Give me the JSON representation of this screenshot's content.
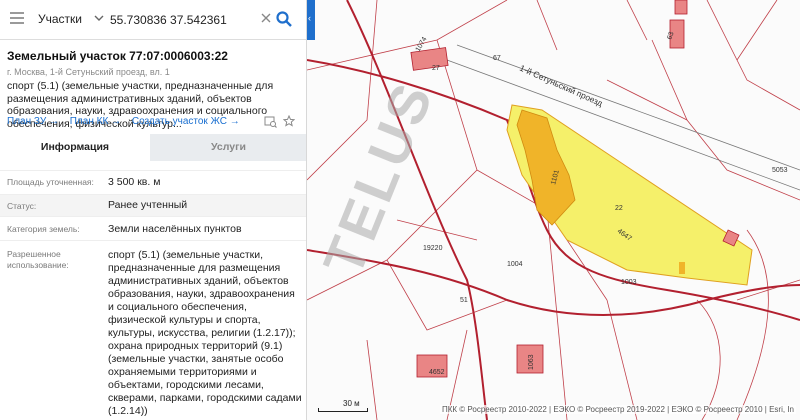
{
  "search": {
    "layer": "Участки",
    "value": "55.730836 37.542361"
  },
  "parcel": {
    "title": "Земельный участок 77:07:0006003:22",
    "address": "г. Москва, 1-й Сетуньский проезд, вл. 1",
    "description": "спорт (5.1) (земельные участки, предназначенные для размещения административных зданий, объектов образования, науки, здравоохранения и социального обеспечения, физической культур...",
    "links": {
      "plan_zu": "План ЗУ →",
      "plan_kk": "План КК →",
      "create_zs": "Создать участок ЖС →"
    }
  },
  "tabs": {
    "info": "Информация",
    "services": "Услуги"
  },
  "attributes": {
    "area_label": "Площадь уточненная:",
    "area_value": "3 500 кв. м",
    "status_label": "Статус:",
    "status_value": "Ранее учтенный",
    "category_label": "Категория земель:",
    "category_value": "Земли населённых пунктов",
    "use_label_1": "Разрешенное",
    "use_label_2": "использование:",
    "use_value": "спорт (5.1) (земельные участки, предназначенные для размещения административных зданий, объектов образования, науки, здравоохранения и социального обеспечения, физической культуры и спорта, культуры, искусства, религии (1.2.17)); охрана природных территорий (9.1) (земельные участки, занятые особо охраняемыми территориями и объектами, городскими лесами, скверами, парками, городскими садами (1.2.14))"
  },
  "map": {
    "street": "1-й Сетуньский проезд",
    "labels": {
      "l1074": "1074",
      "l27": "27",
      "l67": "67",
      "l63": "63",
      "l22": "22",
      "l4647": "4647",
      "l19220": "19220",
      "l1004": "1004",
      "l1003": "1003",
      "l51": "51",
      "l5053": "5053",
      "l4652": "4652",
      "l1063": "1063",
      "l1101": "1101"
    },
    "watermark": "TELUS",
    "scale": "30 м",
    "attribution": "ПКК © Росреестр 2010-2022 | ЕЭКО © Росреестр 2019-2022 | ЕЭКО © Росреестр 2010 | Esri, In"
  },
  "colors": {
    "parcel_fill": "#f5f06a",
    "parcel_building": "#f0b429",
    "boundary": "#b2202f",
    "link": "#1a6fd0",
    "collapse_tab": "#1f6fcc"
  }
}
